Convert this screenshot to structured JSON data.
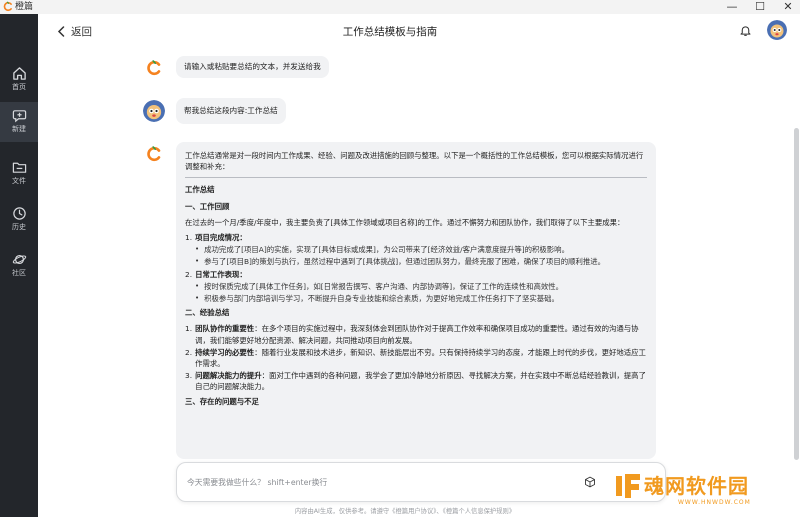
{
  "app": {
    "title": "橙篇"
  },
  "window_controls": [
    "—",
    "☐",
    "✕"
  ],
  "sidebar": {
    "items": [
      {
        "label": "首页",
        "icon": "home-icon"
      },
      {
        "label": "新建",
        "icon": "new-chat-icon",
        "active": true
      },
      {
        "label": "文件",
        "icon": "folder-icon"
      },
      {
        "label": "历史",
        "icon": "history-icon"
      },
      {
        "label": "社区",
        "icon": "planet-icon"
      }
    ]
  },
  "header": {
    "back_label": "返回",
    "title": "工作总结模板与指南"
  },
  "messages": {
    "bot_prompt": "请输入或粘贴要总结的文本，并发送给我",
    "user_request": "帮我总结这段内容:工作总结"
  },
  "answer": {
    "intro": "工作总结通常是对一段时间内工作成果、经验、问题及改进措施的回顾与整理。以下是一个概括性的工作总结模板，您可以根据实际情况进行调整和补充：",
    "doc_title": "工作总结",
    "s1": {
      "heading": "一、工作回顾",
      "para": "在过去的一个月/季度/年度中，我主要负责了[具体工作领域或项目名称]的工作。通过不懈努力和团队协作，我们取得了以下主要成果：",
      "i1_num": "1.",
      "i1_title": "项目完成情况：",
      "i1_b1": "成功完成了[项目A]的实施，实现了[具体目标或成果]，为公司带来了[经济效益/客户满意度提升等]的积极影响。",
      "i1_b2": "参与了[项目B]的策划与执行，虽然过程中遇到了[具体挑战]，但通过团队努力，最终克服了困难，确保了项目的顺利推进。",
      "i2_num": "2.",
      "i2_title": "日常工作表现：",
      "i2_b1": "按时保质完成了[具体工作任务]，如[日常报告撰写、客户沟通、内部协调等]，保证了工作的连续性和高效性。",
      "i2_b2": "积极参与部门内部培训与学习，不断提升自身专业技能和综合素质，为更好地完成工作任务打下了坚实基础。"
    },
    "s2": {
      "heading": "二、经验总结",
      "i1_num": "1.",
      "i1_title": "团队协作的重要性",
      "i1_text": "：在多个项目的实施过程中，我深刻体会到团队协作对于提高工作效率和确保项目成功的重要性。通过有效的沟通与协调，我们能够更好地分配资源、解决问题，共同推动项目向前发展。",
      "i2_num": "2.",
      "i2_title": "持续学习的必要性",
      "i2_text": "：随着行业发展和技术进步，新知识、新技能层出不穷。只有保持持续学习的态度，才能跟上时代的步伐，更好地适应工作需求。",
      "i3_num": "3.",
      "i3_title": "问题解决能力的提升",
      "i3_text": "：面对工作中遇到的各种问题，我学会了更加冷静地分析原因、寻找解决方案，并在实践中不断总结经验教训，提高了自己的问题解决能力。",
      "cut_off": "三、存在的问题与不足"
    }
  },
  "input": {
    "placeholder": "今天需要我做些什么？ shift+enter换行"
  },
  "footer_note": "内容由AI生成，仅供参考。请遵守《橙篇用户协议》、《橙篇个人信息保护规则》",
  "watermark": {
    "brand": "魂网软件园",
    "url": "WWW.HNWDW.COM"
  },
  "colors": {
    "accent": "#f5821f",
    "sidebar_bg": "#23262b",
    "bubble_bg": "#f1f2f4",
    "watermark": "#f19a1f"
  }
}
